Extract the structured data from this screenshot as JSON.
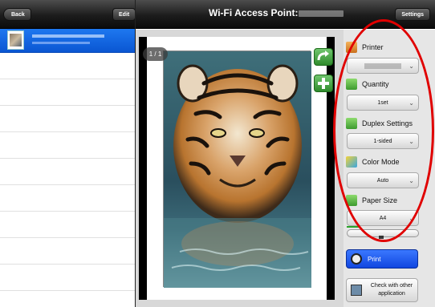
{
  "header": {
    "back_label": "Back",
    "edit_label": "Edit",
    "title": "Wi-Fi Access Point:",
    "settings_label": "Settings"
  },
  "preview": {
    "page_indicator": "1 / 1"
  },
  "panel": {
    "printer_label": "Printer",
    "quantity_label": "Quantity",
    "quantity_value": "1set",
    "duplex_label": "Duplex Settings",
    "duplex_value": "1-sided",
    "color_label": "Color Mode",
    "color_value": "Auto",
    "paper_label": "Paper Size",
    "paper_value": "A4",
    "print_label": "Print",
    "check_label": "Check with other application"
  },
  "icons": [
    "back-icon",
    "rotate-icon",
    "add-icon",
    "printer-icon",
    "quantity-icon",
    "duplex-icon",
    "color-icon",
    "paper-icon",
    "print-icon",
    "check-icon"
  ],
  "colors": {
    "accent_blue": "#0a56d2",
    "print_blue": "#1146e0",
    "action_green": "#2f8a2c",
    "highlight_red": "#e00000"
  }
}
